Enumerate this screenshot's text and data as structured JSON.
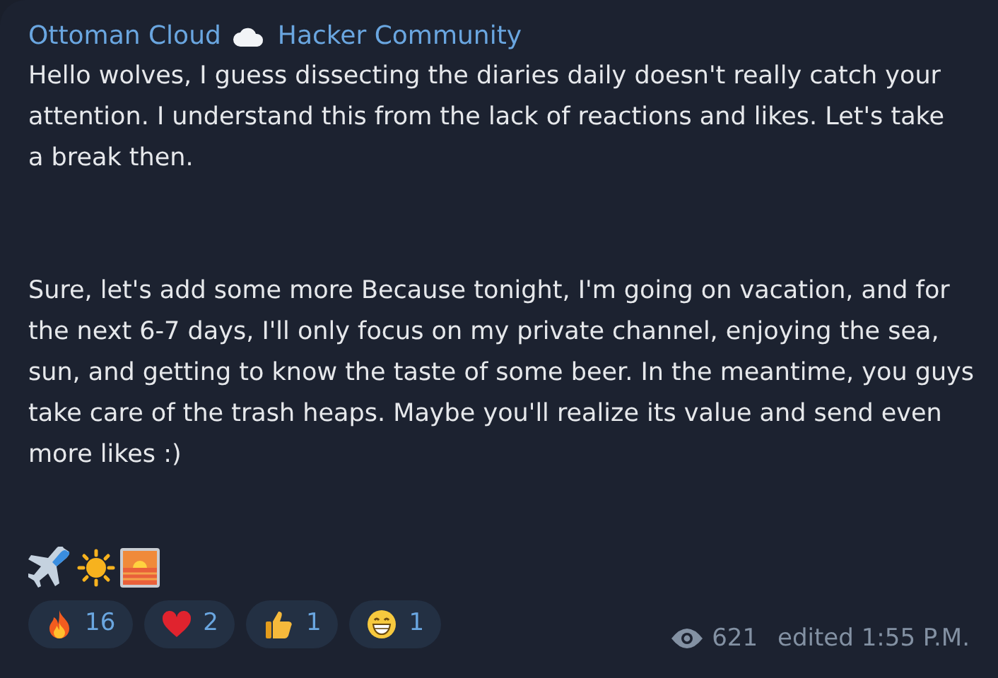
{
  "channel": {
    "name_start": "Ottoman Cloud",
    "name_end": "Hacker Community"
  },
  "paragraphs": [
    "Hello wolves, I guess dissecting the diaries daily doesn't really catch your attention. I understand this from the lack of reactions and likes. Let's take a break then.",
    "Sure, let's add some more Because tonight, I'm going on vacation, and for the next 6-7 days, I'll only focus on my private channel, enjoying the sea, sun, and getting to know the taste of some beer. In the meantime, you guys take care of the trash heaps. Maybe you'll realize its value and send even more likes :)"
  ],
  "reactions": [
    {
      "kind": "fire",
      "count": "16"
    },
    {
      "kind": "heart",
      "count": "2"
    },
    {
      "kind": "thumbs",
      "count": "1"
    },
    {
      "kind": "grin",
      "count": "1"
    }
  ],
  "views": "621",
  "edited": "edited 1:55 P.M."
}
